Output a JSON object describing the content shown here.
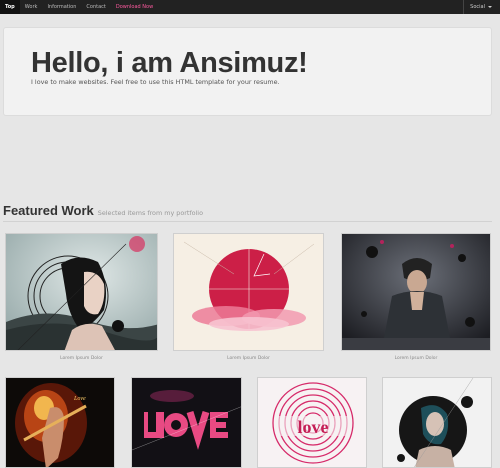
{
  "navbar": {
    "items": [
      {
        "label": "Top",
        "state": "active"
      },
      {
        "label": "Work",
        "state": ""
      },
      {
        "label": "Information",
        "state": ""
      },
      {
        "label": "Contact",
        "state": ""
      },
      {
        "label": "Download Now",
        "state": "highlight"
      }
    ],
    "social_label": "Social",
    "social_icon": "chevron-down-icon"
  },
  "hero": {
    "title": "Hello, i am Ansimuz!",
    "subtitle": "I love to make websites. Feel free to use this HTML template for your resume."
  },
  "featured": {
    "title": "Featured Work",
    "subtitle": "Selected items from my portfolio"
  },
  "portfolio": {
    "row1": [
      {
        "caption": "Lorem Ipsum Dolor",
        "image": "woman portrait with circles artwork"
      },
      {
        "caption": "Lorem Ipsum Dolor",
        "image": "red circle pink clouds artwork"
      },
      {
        "caption": "Lorem Ipsum Dolor",
        "image": "man praying dark abstract artwork"
      }
    ],
    "row2": [
      {
        "image": "woman with guitar fire artwork"
      },
      {
        "image": "love typography dark artwork"
      },
      {
        "image": "love pink circles artwork"
      },
      {
        "image": "woman black splash artwork"
      }
    ]
  },
  "colors": {
    "navbar_bg": "#222222",
    "highlight": "#ff5aa0",
    "page_bg": "#e6e6e6"
  }
}
